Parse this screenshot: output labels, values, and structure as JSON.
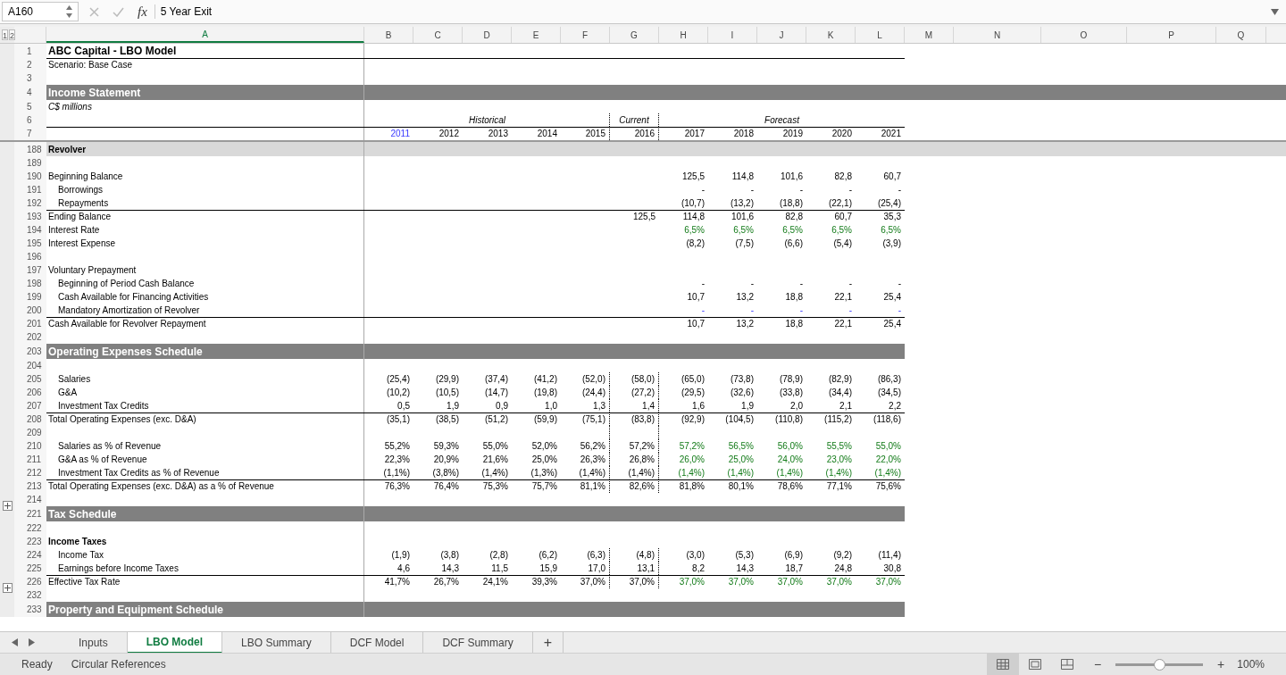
{
  "formula_bar": {
    "name_box": "A160",
    "function_label": "fx",
    "value": "5 Year Exit"
  },
  "outline_levels": [
    "1",
    "2"
  ],
  "columns": [
    {
      "letter": "A",
      "selected": true
    },
    {
      "letter": "B",
      "selected": false
    },
    {
      "letter": "C",
      "selected": false
    },
    {
      "letter": "D",
      "selected": false
    },
    {
      "letter": "E",
      "selected": false
    },
    {
      "letter": "F",
      "selected": false
    },
    {
      "letter": "G",
      "selected": false
    },
    {
      "letter": "H",
      "selected": false
    },
    {
      "letter": "I",
      "selected": false
    },
    {
      "letter": "J",
      "selected": false
    },
    {
      "letter": "K",
      "selected": false
    },
    {
      "letter": "L",
      "selected": false
    },
    {
      "letter": "M",
      "selected": false
    },
    {
      "letter": "N",
      "selected": false
    },
    {
      "letter": "O",
      "selected": false
    },
    {
      "letter": "P",
      "selected": false
    },
    {
      "letter": "Q",
      "selected": false
    }
  ],
  "frozen_rows": [
    {
      "number": "1",
      "kind": "title",
      "label": "ABC Capital - LBO Model"
    },
    {
      "number": "2",
      "kind": "text",
      "label": "Scenario: Base Case",
      "rule_above": true
    },
    {
      "number": "3",
      "kind": "text"
    },
    {
      "number": "4",
      "kind": "banner",
      "label": "Income Statement"
    },
    {
      "number": "5",
      "kind": "italic",
      "label": "C$ millions"
    },
    {
      "number": "6",
      "kind": "period",
      "period_lines": true,
      "cells": [
        null,
        null,
        "Historical",
        null,
        null,
        "Current",
        null,
        null,
        "Forecast",
        null,
        null
      ]
    },
    {
      "number": "7",
      "kind": "text",
      "rule_above": true,
      "period_lines": true,
      "cells": [
        {
          "text": "2011",
          "kind": "link"
        },
        "2012",
        "2013",
        "2014",
        "2015",
        "2016",
        "2017",
        "2018",
        "2019",
        "2020",
        "2021"
      ]
    }
  ],
  "rows": [
    {
      "number": "188",
      "kind": "subsection",
      "label": "Revolver"
    },
    {
      "number": "189",
      "kind": "text"
    },
    {
      "number": "190",
      "kind": "text",
      "label": "Beginning Balance",
      "cells": [
        null,
        null,
        null,
        null,
        null,
        null,
        "125,5",
        "114,8",
        "101,6",
        "82,8",
        "60,7"
      ]
    },
    {
      "number": "191",
      "kind": "text",
      "indent": true,
      "label": "Borrowings",
      "cells": [
        null,
        null,
        null,
        null,
        null,
        null,
        "-",
        "-",
        "-",
        "-",
        "-"
      ]
    },
    {
      "number": "192",
      "kind": "text",
      "indent": true,
      "label": "Repayments",
      "cells": [
        null,
        null,
        null,
        null,
        null,
        null,
        "(10,7)",
        "(13,2)",
        "(18,8)",
        "(22,1)",
        "(25,4)"
      ]
    },
    {
      "number": "193",
      "kind": "text",
      "rule_above": true,
      "label": "Ending Balance",
      "cells": [
        null,
        null,
        null,
        null,
        null,
        "125,5",
        "114,8",
        "101,6",
        "82,8",
        "60,7",
        "35,3"
      ]
    },
    {
      "number": "194",
      "kind": "text",
      "label": "Interest Rate",
      "cells": [
        null,
        null,
        null,
        null,
        null,
        null,
        {
          "text": "6,5%",
          "kind": "input"
        },
        {
          "text": "6,5%",
          "kind": "input"
        },
        {
          "text": "6,5%",
          "kind": "input"
        },
        {
          "text": "6,5%",
          "kind": "input"
        },
        {
          "text": "6,5%",
          "kind": "input"
        }
      ]
    },
    {
      "number": "195",
      "kind": "text",
      "label": "Interest Expense",
      "cells": [
        null,
        null,
        null,
        null,
        null,
        null,
        "(8,2)",
        "(7,5)",
        "(6,6)",
        "(5,4)",
        "(3,9)"
      ]
    },
    {
      "number": "196",
      "kind": "text"
    },
    {
      "number": "197",
      "kind": "text",
      "label": "Voluntary Prepayment"
    },
    {
      "number": "198",
      "kind": "text",
      "indent": true,
      "label": "Beginning of Period Cash Balance",
      "cells": [
        null,
        null,
        null,
        null,
        null,
        null,
        "-",
        "-",
        "-",
        "-",
        "-"
      ]
    },
    {
      "number": "199",
      "kind": "text",
      "indent": true,
      "label": "Cash Available for Financing Activities",
      "cells": [
        null,
        null,
        null,
        null,
        null,
        null,
        "10,7",
        "13,2",
        "18,8",
        "22,1",
        "25,4"
      ]
    },
    {
      "number": "200",
      "kind": "text",
      "indent": true,
      "label": "Mandatory Amortization of Revolver",
      "cells": [
        null,
        null,
        null,
        null,
        null,
        null,
        {
          "text": "-",
          "kind": "link"
        },
        {
          "text": "-",
          "kind": "link"
        },
        {
          "text": "-",
          "kind": "link"
        },
        {
          "text": "-",
          "kind": "link"
        },
        {
          "text": "-",
          "kind": "link"
        }
      ]
    },
    {
      "number": "201",
      "kind": "text",
      "rule_above": true,
      "label": "Cash Available for Revolver Repayment",
      "cells": [
        null,
        null,
        null,
        null,
        null,
        null,
        "10,7",
        "13,2",
        "18,8",
        "22,1",
        "25,4"
      ]
    },
    {
      "number": "202",
      "kind": "text"
    },
    {
      "number": "203",
      "kind": "section",
      "label": "Operating Expenses Schedule"
    },
    {
      "number": "204",
      "kind": "text"
    },
    {
      "number": "205",
      "kind": "text",
      "indent": true,
      "period_lines": true,
      "label": "Salaries",
      "cells": [
        "(25,4)",
        "(29,9)",
        "(37,4)",
        "(41,2)",
        "(52,0)",
        "(58,0)",
        "(65,0)",
        "(73,8)",
        "(78,9)",
        "(82,9)",
        "(86,3)"
      ]
    },
    {
      "number": "206",
      "kind": "text",
      "indent": true,
      "period_lines": true,
      "label": "G&A",
      "cells": [
        "(10,2)",
        "(10,5)",
        "(14,7)",
        "(19,8)",
        "(24,4)",
        "(27,2)",
        "(29,5)",
        "(32,6)",
        "(33,8)",
        "(34,4)",
        "(34,5)"
      ]
    },
    {
      "number": "207",
      "kind": "text",
      "indent": true,
      "period_lines": true,
      "label": "Investment Tax Credits",
      "cells": [
        "0,5",
        "1,9",
        "0,9",
        "1,0",
        "1,3",
        "1,4",
        "1,6",
        "1,9",
        "2,0",
        "2,1",
        "2,2"
      ]
    },
    {
      "number": "208",
      "kind": "text",
      "rule_above": true,
      "period_lines": true,
      "label": "Total Operating Expenses (exc. D&A)",
      "cells": [
        "(35,1)",
        "(38,5)",
        "(51,2)",
        "(59,9)",
        "(75,1)",
        "(83,8)",
        "(92,9)",
        "(104,5)",
        "(110,8)",
        "(115,2)",
        "(118,6)"
      ]
    },
    {
      "number": "209",
      "kind": "text",
      "period_lines": true
    },
    {
      "number": "210",
      "kind": "text",
      "indent": true,
      "period_lines": true,
      "label": "Salaries as % of Revenue",
      "cells": [
        "55,2%",
        "59,3%",
        "55,0%",
        "52,0%",
        "56,2%",
        "57,2%",
        {
          "text": "57,2%",
          "kind": "input"
        },
        {
          "text": "56,5%",
          "kind": "input"
        },
        {
          "text": "56,0%",
          "kind": "input"
        },
        {
          "text": "55,5%",
          "kind": "input"
        },
        {
          "text": "55,0%",
          "kind": "input"
        }
      ]
    },
    {
      "number": "211",
      "kind": "text",
      "indent": true,
      "period_lines": true,
      "label": "G&A as % of Revenue",
      "cells": [
        "22,3%",
        "20,9%",
        "21,6%",
        "25,0%",
        "26,3%",
        "26,8%",
        {
          "text": "26,0%",
          "kind": "input"
        },
        {
          "text": "25,0%",
          "kind": "input"
        },
        {
          "text": "24,0%",
          "kind": "input"
        },
        {
          "text": "23,0%",
          "kind": "input"
        },
        {
          "text": "22,0%",
          "kind": "input"
        }
      ]
    },
    {
      "number": "212",
      "kind": "text",
      "indent": true,
      "period_lines": true,
      "label": "Investment Tax Credits as % of Revenue",
      "cells": [
        "(1,1%)",
        "(3,8%)",
        "(1,4%)",
        "(1,3%)",
        "(1,4%)",
        "(1,4%)",
        {
          "text": "(1,4%)",
          "kind": "input"
        },
        {
          "text": "(1,4%)",
          "kind": "input"
        },
        {
          "text": "(1,4%)",
          "kind": "input"
        },
        {
          "text": "(1,4%)",
          "kind": "input"
        },
        {
          "text": "(1,4%)",
          "kind": "input"
        }
      ]
    },
    {
      "number": "213",
      "kind": "text",
      "rule_above": true,
      "period_lines": true,
      "label": "Total Operating Expenses (exc. D&A) as a % of Revenue",
      "cells": [
        "76,3%",
        "76,4%",
        "75,3%",
        "75,7%",
        "81,1%",
        "82,6%",
        "81,8%",
        "80,1%",
        "78,6%",
        "77,1%",
        "75,6%"
      ]
    },
    {
      "number": "214",
      "kind": "text"
    },
    {
      "number": "221",
      "kind": "section",
      "collapsed_above": true,
      "label": "Tax Schedule"
    },
    {
      "number": "222",
      "kind": "text"
    },
    {
      "number": "223",
      "kind": "bold",
      "label": "Income Taxes"
    },
    {
      "number": "224",
      "kind": "text",
      "indent": true,
      "period_lines": true,
      "label": "Income Tax",
      "cells": [
        "(1,9)",
        "(3,8)",
        "(2,8)",
        "(6,2)",
        "(6,3)",
        "(4,8)",
        "(3,0)",
        "(5,3)",
        "(6,9)",
        "(9,2)",
        "(11,4)"
      ]
    },
    {
      "number": "225",
      "kind": "text",
      "indent": true,
      "period_lines": true,
      "label": "Earnings before Income Taxes",
      "cells": [
        "4,6",
        "14,3",
        "11,5",
        "15,9",
        "17,0",
        "13,1",
        "8,2",
        "14,3",
        "18,7",
        "24,8",
        "30,8"
      ]
    },
    {
      "number": "226",
      "kind": "text",
      "rule_above": true,
      "period_lines": true,
      "label": "Effective Tax Rate",
      "cells": [
        "41,7%",
        "26,7%",
        "24,1%",
        "39,3%",
        "37,0%",
        "37,0%",
        {
          "text": "37,0%",
          "kind": "input"
        },
        {
          "text": "37,0%",
          "kind": "input"
        },
        {
          "text": "37,0%",
          "kind": "input"
        },
        {
          "text": "37,0%",
          "kind": "input"
        },
        {
          "text": "37,0%",
          "kind": "input"
        }
      ]
    },
    {
      "number": "232",
      "kind": "text",
      "collapsed_above": true
    },
    {
      "number": "233",
      "kind": "section",
      "label": "Property and Equipment Schedule"
    }
  ],
  "sheet_tabs": [
    {
      "label": "Inputs",
      "selected": false
    },
    {
      "label": "LBO Model",
      "selected": true
    },
    {
      "label": "LBO Summary",
      "selected": false
    },
    {
      "label": "DCF Model",
      "selected": false
    },
    {
      "label": "DCF Summary",
      "selected": false
    }
  ],
  "add_sheet": "+",
  "status_bar": {
    "items": [
      "Ready",
      "Circular References"
    ],
    "zoom_out": "−",
    "zoom_in": "+",
    "zoom": {
      "level": 0.5
    },
    "zoom_label": "100%"
  }
}
